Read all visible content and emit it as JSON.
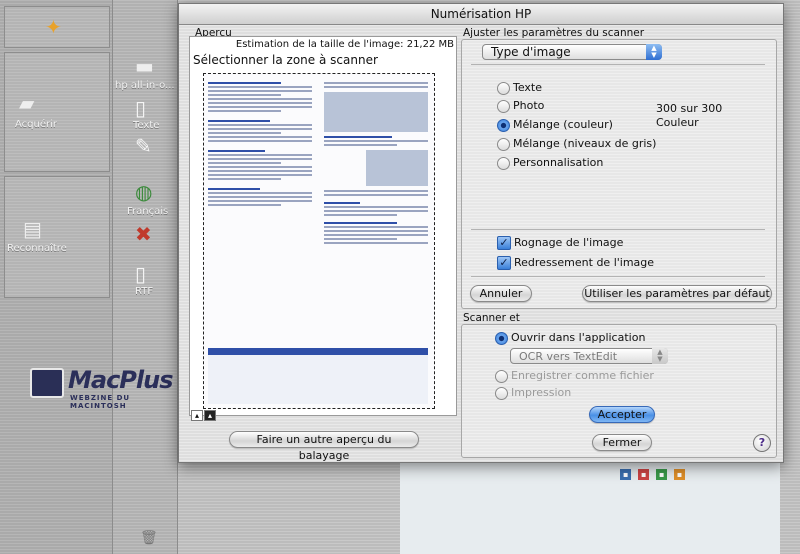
{
  "window": {
    "title": "Numérisation HP"
  },
  "background_app": {
    "toolbar": {
      "acquire_label": "Acquérir",
      "hp_label": "hp all-in-o...",
      "text_label": "Texte",
      "recognize_label": "Reconnaître",
      "francais_label": "Français",
      "rtf_label": "RTF"
    },
    "logo": {
      "name": "MacPlus",
      "tagline": "WEBZINE DU MACINTOSH"
    }
  },
  "preview": {
    "section_label": "Aperçu",
    "size_estimate": "Estimation de la taille de l'image: 21,22 MB",
    "select_zone": "Sélectionner la zone à scanner",
    "rescan_button": "Faire un autre aperçu du balayage"
  },
  "settings": {
    "section_label": "Ajuster les paramètres du scanner",
    "image_type_popup": "Type d'image",
    "image_types": [
      "Texte",
      "Photo",
      "Mélange (couleur)",
      "Mélange (niveaux de gris)",
      "Personnalisation"
    ],
    "selected_image_type": "Mélange (couleur)",
    "resolution_line1": "300 sur 300",
    "resolution_line2": "Couleur",
    "crop_label": "Rognage de l'image",
    "crop_checked": true,
    "straighten_label": "Redressement de l'image",
    "straighten_checked": true,
    "cancel_button": "Annuler",
    "defaults_button": "Utiliser les paramètres par défaut"
  },
  "scan_to": {
    "section_label": "Scanner et",
    "open_in_app_label": "Ouvrir dans l'application",
    "app_popup": "OCR vers TextEdit",
    "save_file_label": "Enregistrer comme fichier",
    "print_label": "Impression",
    "accept_button": "Accepter",
    "close_button": "Fermer",
    "help_button": "?"
  },
  "colors": {
    "aqua_blue": "#4a90e6",
    "doc_blue": "#2f4fa8",
    "logo_navy": "#2b2f5a"
  }
}
